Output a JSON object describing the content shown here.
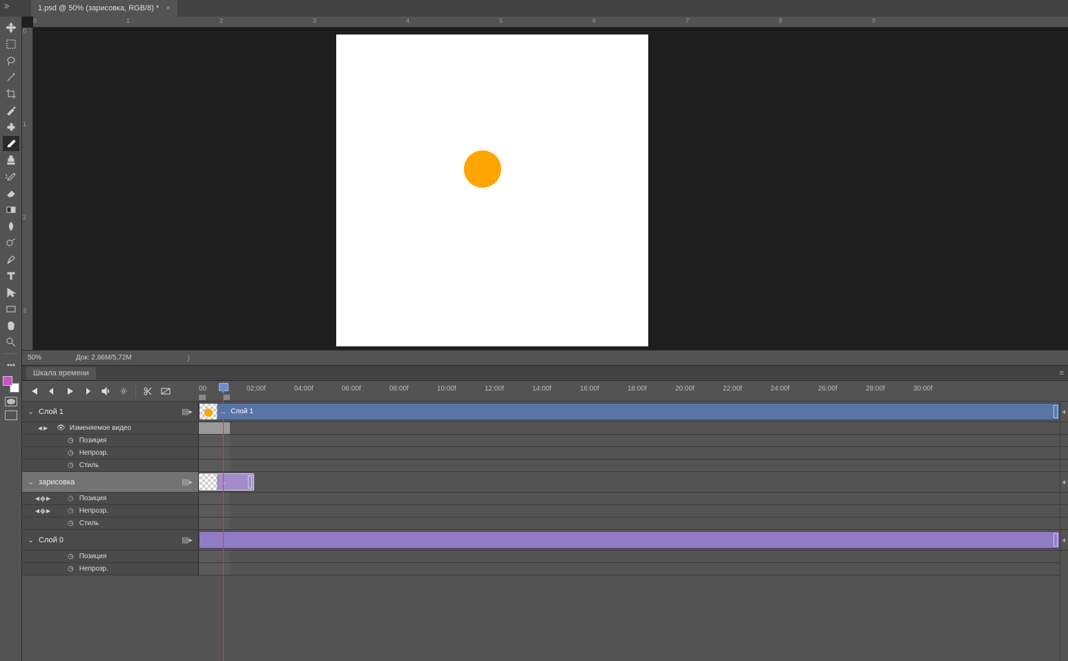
{
  "tab": {
    "title": "1.psd @ 50% (зарисовка, RGB/8) *"
  },
  "ruler_h": [
    "0",
    "1",
    "2",
    "3",
    "4",
    "5",
    "6",
    "7",
    "8",
    "9"
  ],
  "ruler_v": [
    "0",
    "1",
    "2",
    "3"
  ],
  "status": {
    "zoom": "50%",
    "doc": "Док: 2,86M/5,72M"
  },
  "timeline": {
    "title": "Шкала времени",
    "ticks": [
      "00",
      "02:00f",
      "04:00f",
      "06:00f",
      "08:00f",
      "10:00f",
      "12:00f",
      "14:00f",
      "16:00f",
      "18:00f",
      "20:00f",
      "22:00f",
      "24:00f",
      "26:00f",
      "28:00f",
      "30:00f"
    ],
    "layers": [
      {
        "name": "Слой 1",
        "clip_name": "Слой 1",
        "props": [
          {
            "name": "Изменяемое видео",
            "stopwatch": false,
            "kf": false,
            "nav": true
          },
          {
            "name": "Позиция",
            "stopwatch": true,
            "kf": false
          },
          {
            "name": "Непрозр.",
            "stopwatch": true,
            "kf": false
          },
          {
            "name": "Стиль",
            "stopwatch": true,
            "kf": false
          }
        ]
      },
      {
        "name": "зарисовка",
        "selected": true,
        "props": [
          {
            "name": "Позиция",
            "stopwatch": true,
            "kf": true
          },
          {
            "name": "Непрозр.",
            "stopwatch": true,
            "kf": true
          },
          {
            "name": "Стиль",
            "stopwatch": true,
            "kf": false
          }
        ]
      },
      {
        "name": "Слой 0",
        "props": [
          {
            "name": "Позиция",
            "stopwatch": true,
            "kf": false
          },
          {
            "name": "Непрозр.",
            "stopwatch": true,
            "kf": false
          }
        ]
      }
    ]
  }
}
